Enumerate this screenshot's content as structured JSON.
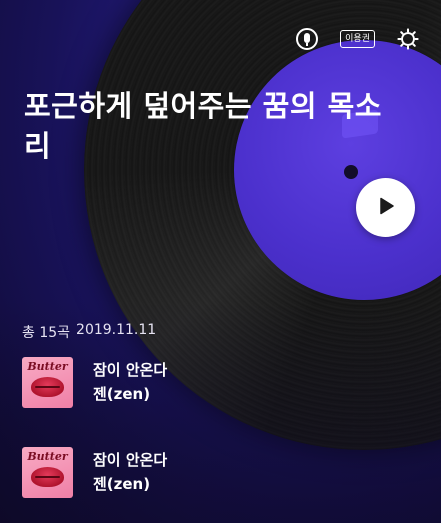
{
  "header": {
    "icons": [
      "mic-icon",
      "ticket-icon",
      "gear-icon"
    ],
    "ticket_label": "이용권"
  },
  "playlist": {
    "title": "포근하게 덮어주는 꿈의 목소리",
    "total_label": "총 15곡",
    "date": "2019.11.11"
  },
  "tracks": [
    {
      "title": "잠이 안온다",
      "artist": "젠(zen)",
      "album_art_text": "Butter"
    },
    {
      "title": "잠이 안온다",
      "artist": "젠(zen)",
      "album_art_text": "Butter"
    }
  ],
  "colors": {
    "background": "#221a78",
    "record_label": "#4b30cc",
    "play_button": "#ffffff",
    "play_icon": "#1a1a1a"
  }
}
